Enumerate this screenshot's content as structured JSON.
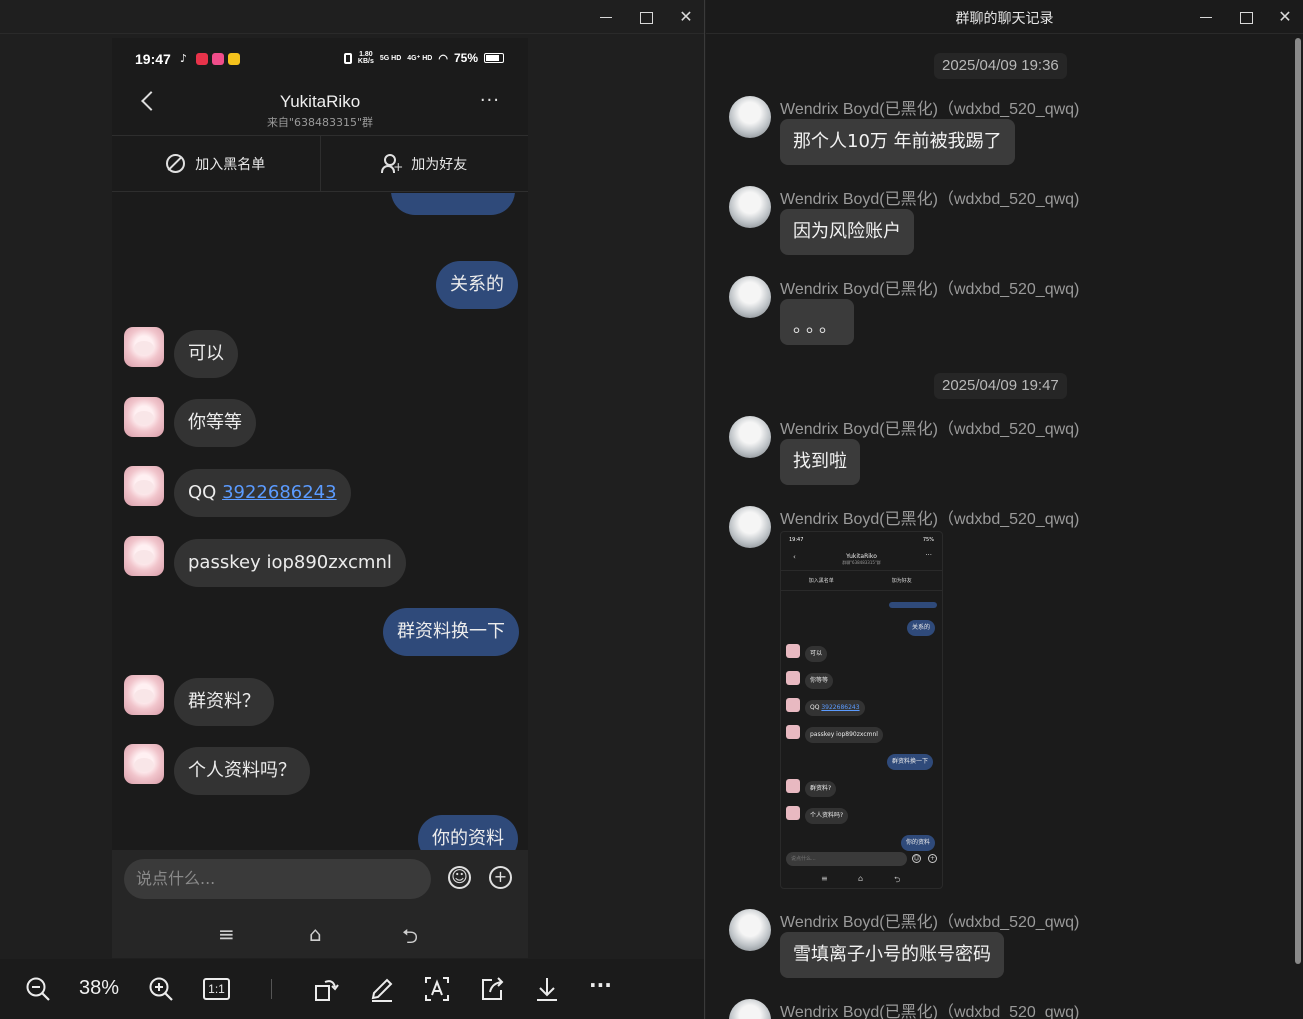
{
  "left_window": {
    "controls": {
      "minimize": "—",
      "maximize": "□",
      "close": "✕"
    }
  },
  "phone": {
    "status": {
      "time": "19:47",
      "speed_top": "1.80",
      "speed_bottom": "KB/s",
      "sig1": "5G HD",
      "sig2": "4G⁺ HD",
      "battery": "75%"
    },
    "chat": {
      "name": "YukitaRiko",
      "subtitle": "来自\"638483315\"群",
      "more": "···"
    },
    "actions": {
      "block": "加入黑名单",
      "add_friend": "加为好友"
    },
    "messages": [
      {
        "side": "right",
        "text": "关系的"
      },
      {
        "side": "left",
        "text": "可以"
      },
      {
        "side": "left",
        "text": "你等等"
      },
      {
        "side": "left",
        "prefix": "QQ ",
        "link": "3922686243"
      },
      {
        "side": "left",
        "text": "passkey iop890zxcmnl"
      },
      {
        "side": "right",
        "text": "群资料换一下"
      },
      {
        "side": "left",
        "text": "群资料？"
      },
      {
        "side": "left",
        "text": "个人资料吗？"
      },
      {
        "side": "right",
        "text": "你的资料"
      }
    ],
    "input_placeholder": "说点什么...",
    "input_buttons": {
      "emoji": "☺",
      "plus": "+"
    },
    "nav": {
      "menu": "≡",
      "home": "⌂",
      "back": "⮌"
    }
  },
  "viewer_toolbar": {
    "zoom_level": "38%",
    "icons": [
      "zoom-out-icon",
      "zoom-in-icon",
      "actual-size-icon",
      "rotate-icon",
      "edit-icon",
      "text-recognize-icon",
      "share-icon",
      "download-icon",
      "more-icon"
    ],
    "actual_size_label": "1:1",
    "more": "···"
  },
  "right_window": {
    "title": "群聊的聊天记录",
    "controls": {
      "minimize": "—",
      "maximize": "□",
      "close": "✕"
    },
    "sender": "Wendrix Boyd(已黑化)（wdxbd_520_qwq)",
    "timestamps": [
      "2025/04/09 19:36",
      "2025/04/09 19:47"
    ],
    "messages": [
      {
        "text": "那个人10万 年前被我踢了"
      },
      {
        "text": "因为风险账户"
      },
      {
        "text": "。。。"
      },
      {
        "text": "找到啦"
      },
      {
        "image": "phone-screenshot-thumbnail"
      },
      {
        "text": "雪填离子小号的账号密码"
      },
      {
        "text": ""
      }
    ]
  },
  "thumbnail": {
    "time": "19:47",
    "battery": "75%",
    "name": "YukitaRiko",
    "subtitle": "群聊\"638483315\"群",
    "block": "加入黑名单",
    "add_friend": "加为好友",
    "messages": [
      "关系的",
      "可以",
      "你等等",
      "QQ ",
      "3922686243",
      "passkey iop890zxcmnl",
      "群资料换一下",
      "群资料?",
      "个人资料吗?",
      "你的资料"
    ],
    "input_placeholder": "说点什么..."
  },
  "colors": {
    "bubble_self": "#2f4a7a",
    "bubble_other": "#333333",
    "link": "#5b9bff",
    "background": "#1f1f1f"
  }
}
